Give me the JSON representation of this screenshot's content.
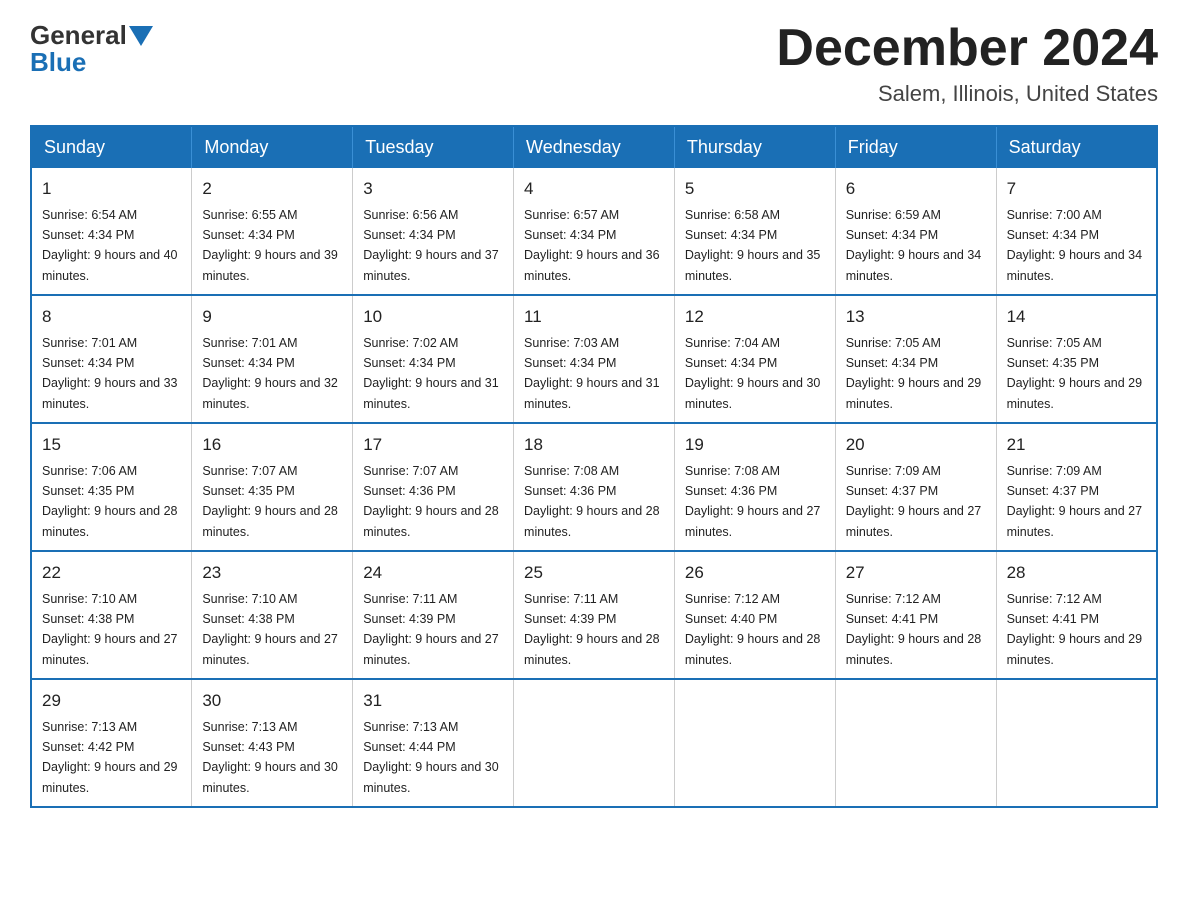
{
  "header": {
    "logo_general": "General",
    "logo_blue": "Blue",
    "month_title": "December 2024",
    "location": "Salem, Illinois, United States"
  },
  "days_of_week": [
    "Sunday",
    "Monday",
    "Tuesday",
    "Wednesday",
    "Thursday",
    "Friday",
    "Saturday"
  ],
  "weeks": [
    [
      {
        "day": "1",
        "sunrise": "6:54 AM",
        "sunset": "4:34 PM",
        "daylight": "9 hours and 40 minutes."
      },
      {
        "day": "2",
        "sunrise": "6:55 AM",
        "sunset": "4:34 PM",
        "daylight": "9 hours and 39 minutes."
      },
      {
        "day": "3",
        "sunrise": "6:56 AM",
        "sunset": "4:34 PM",
        "daylight": "9 hours and 37 minutes."
      },
      {
        "day": "4",
        "sunrise": "6:57 AM",
        "sunset": "4:34 PM",
        "daylight": "9 hours and 36 minutes."
      },
      {
        "day": "5",
        "sunrise": "6:58 AM",
        "sunset": "4:34 PM",
        "daylight": "9 hours and 35 minutes."
      },
      {
        "day": "6",
        "sunrise": "6:59 AM",
        "sunset": "4:34 PM",
        "daylight": "9 hours and 34 minutes."
      },
      {
        "day": "7",
        "sunrise": "7:00 AM",
        "sunset": "4:34 PM",
        "daylight": "9 hours and 34 minutes."
      }
    ],
    [
      {
        "day": "8",
        "sunrise": "7:01 AM",
        "sunset": "4:34 PM",
        "daylight": "9 hours and 33 minutes."
      },
      {
        "day": "9",
        "sunrise": "7:01 AM",
        "sunset": "4:34 PM",
        "daylight": "9 hours and 32 minutes."
      },
      {
        "day": "10",
        "sunrise": "7:02 AM",
        "sunset": "4:34 PM",
        "daylight": "9 hours and 31 minutes."
      },
      {
        "day": "11",
        "sunrise": "7:03 AM",
        "sunset": "4:34 PM",
        "daylight": "9 hours and 31 minutes."
      },
      {
        "day": "12",
        "sunrise": "7:04 AM",
        "sunset": "4:34 PM",
        "daylight": "9 hours and 30 minutes."
      },
      {
        "day": "13",
        "sunrise": "7:05 AM",
        "sunset": "4:34 PM",
        "daylight": "9 hours and 29 minutes."
      },
      {
        "day": "14",
        "sunrise": "7:05 AM",
        "sunset": "4:35 PM",
        "daylight": "9 hours and 29 minutes."
      }
    ],
    [
      {
        "day": "15",
        "sunrise": "7:06 AM",
        "sunset": "4:35 PM",
        "daylight": "9 hours and 28 minutes."
      },
      {
        "day": "16",
        "sunrise": "7:07 AM",
        "sunset": "4:35 PM",
        "daylight": "9 hours and 28 minutes."
      },
      {
        "day": "17",
        "sunrise": "7:07 AM",
        "sunset": "4:36 PM",
        "daylight": "9 hours and 28 minutes."
      },
      {
        "day": "18",
        "sunrise": "7:08 AM",
        "sunset": "4:36 PM",
        "daylight": "9 hours and 28 minutes."
      },
      {
        "day": "19",
        "sunrise": "7:08 AM",
        "sunset": "4:36 PM",
        "daylight": "9 hours and 27 minutes."
      },
      {
        "day": "20",
        "sunrise": "7:09 AM",
        "sunset": "4:37 PM",
        "daylight": "9 hours and 27 minutes."
      },
      {
        "day": "21",
        "sunrise": "7:09 AM",
        "sunset": "4:37 PM",
        "daylight": "9 hours and 27 minutes."
      }
    ],
    [
      {
        "day": "22",
        "sunrise": "7:10 AM",
        "sunset": "4:38 PM",
        "daylight": "9 hours and 27 minutes."
      },
      {
        "day": "23",
        "sunrise": "7:10 AM",
        "sunset": "4:38 PM",
        "daylight": "9 hours and 27 minutes."
      },
      {
        "day": "24",
        "sunrise": "7:11 AM",
        "sunset": "4:39 PM",
        "daylight": "9 hours and 27 minutes."
      },
      {
        "day": "25",
        "sunrise": "7:11 AM",
        "sunset": "4:39 PM",
        "daylight": "9 hours and 28 minutes."
      },
      {
        "day": "26",
        "sunrise": "7:12 AM",
        "sunset": "4:40 PM",
        "daylight": "9 hours and 28 minutes."
      },
      {
        "day": "27",
        "sunrise": "7:12 AM",
        "sunset": "4:41 PM",
        "daylight": "9 hours and 28 minutes."
      },
      {
        "day": "28",
        "sunrise": "7:12 AM",
        "sunset": "4:41 PM",
        "daylight": "9 hours and 29 minutes."
      }
    ],
    [
      {
        "day": "29",
        "sunrise": "7:13 AM",
        "sunset": "4:42 PM",
        "daylight": "9 hours and 29 minutes."
      },
      {
        "day": "30",
        "sunrise": "7:13 AM",
        "sunset": "4:43 PM",
        "daylight": "9 hours and 30 minutes."
      },
      {
        "day": "31",
        "sunrise": "7:13 AM",
        "sunset": "4:44 PM",
        "daylight": "9 hours and 30 minutes."
      },
      null,
      null,
      null,
      null
    ]
  ]
}
